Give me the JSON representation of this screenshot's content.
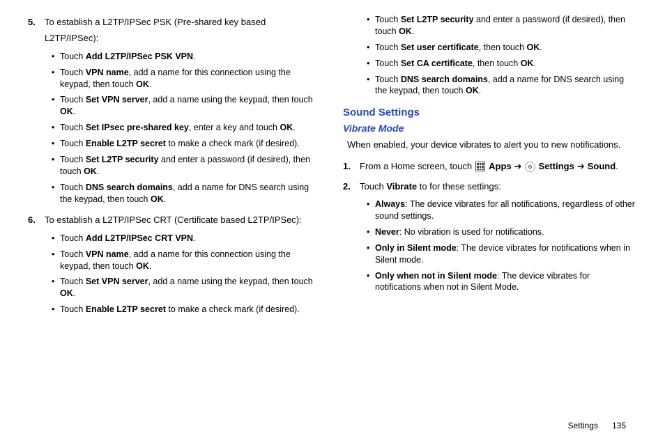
{
  "left": {
    "step5": {
      "num": "5.",
      "intro": "To establish a L2TP/IPSec PSK (Pre-shared key based L2TP/IPSec):",
      "bullets": [
        {
          "pre": "Touch ",
          "b": "Add L2TP/IPSec PSK VPN",
          "post": "."
        },
        {
          "pre": "Touch ",
          "b": "VPN name",
          "post": ", add a name for this connection using the keypad, then touch ",
          "b2": "OK",
          "post2": "."
        },
        {
          "pre": "Touch ",
          "b": "Set VPN server",
          "post": ", add a name using the keypad, then touch ",
          "b2": "OK",
          "post2": "."
        },
        {
          "pre": "Touch ",
          "b": "Set IPsec pre-shared key",
          "post": ", enter a key and touch ",
          "b2": "OK",
          "post2": "."
        },
        {
          "pre": "Touch ",
          "b": "Enable L2TP secret",
          "post": " to make a check mark (if desired)."
        },
        {
          "pre": "Touch ",
          "b": "Set L2TP security",
          "post": " and enter a password (if desired), then touch ",
          "b2": "OK",
          "post2": "."
        },
        {
          "pre": "Touch ",
          "b": "DNS search domains",
          "post": ", add a name for DNS search using the keypad, then touch ",
          "b2": "OK",
          "post2": "."
        }
      ]
    },
    "step6": {
      "num": "6.",
      "intro": "To establish a L2TP/IPSec CRT (Certificate based L2TP/IPSec):",
      "bullets": [
        {
          "pre": "Touch ",
          "b": "Add L2TP/IPSec CRT VPN",
          "post": "."
        },
        {
          "pre": "Touch ",
          "b": "VPN name",
          "post": ", add a name for this connection using the keypad, then touch ",
          "b2": "OK",
          "post2": "."
        },
        {
          "pre": "Touch ",
          "b": "Set VPN server",
          "post": ", add a name using the keypad, then touch ",
          "b2": "OK",
          "post2": "."
        },
        {
          "pre": "Touch ",
          "b": "Enable L2TP secret",
          "post": " to make a check mark (if desired)."
        }
      ]
    }
  },
  "right": {
    "cont_bullets": [
      {
        "pre": "Touch ",
        "b": "Set L2TP security",
        "post": " and enter a password (if desired), then touch ",
        "b2": "OK",
        "post2": "."
      },
      {
        "pre": "Touch ",
        "b": "Set user certificate",
        "post": ", then touch ",
        "b2": "OK",
        "post2": "."
      },
      {
        "pre": "Touch ",
        "b": "Set CA certificate",
        "post": ", then touch ",
        "b2": "OK",
        "post2": "."
      },
      {
        "pre": "Touch ",
        "b": "DNS search domains",
        "post": ", add a name for DNS search using the keypad, then touch ",
        "b2": "OK",
        "post2": "."
      }
    ],
    "h2": "Sound Settings",
    "h3": "Vibrate Mode",
    "para": "When enabled, your device vibrates to alert you to new notifications.",
    "step1": {
      "num": "1.",
      "pre": "From a Home screen, touch ",
      "apps": "Apps",
      "arrow1": "➔",
      "settings": "Settings",
      "arrow2": "➔",
      "sound": "Sound",
      "dot": "."
    },
    "step2": {
      "num": "2.",
      "pre": "Touch ",
      "b": "Vibrate",
      "post": " to for these settings:",
      "bullets": [
        {
          "b": "Always",
          "post": ": The device vibrates for all notifications, regardless of other sound settings."
        },
        {
          "b": "Never",
          "post": ": No vibration is used for notifications."
        },
        {
          "b": "Only in Silent mode",
          "post": ": The device vibrates for notifications when in Silent mode."
        },
        {
          "b": "Only when not in Silent mode",
          "post": ": The device vibrates for notifications when not in Silent Mode."
        }
      ]
    }
  },
  "footer": {
    "section": "Settings",
    "page": "135"
  }
}
